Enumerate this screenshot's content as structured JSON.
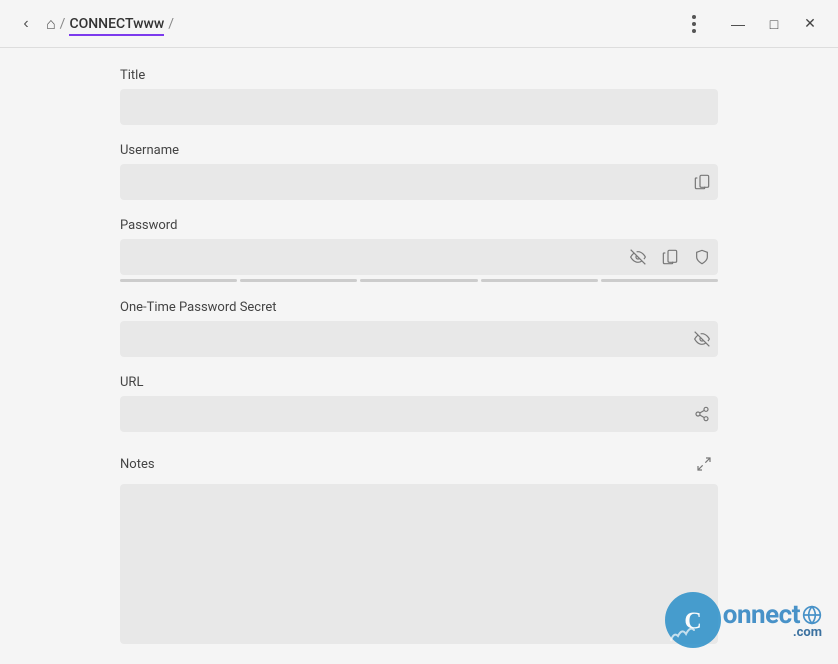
{
  "titlebar": {
    "back_label": "‹",
    "home_icon": "⌂",
    "separator": "/",
    "breadcrumb_root": "CONNECTwww",
    "breadcrumb_sep2": "/",
    "menu_dots": "⋮",
    "minimize_label": "—",
    "maximize_label": "□",
    "close_label": "✕"
  },
  "form": {
    "title_label": "Title",
    "title_placeholder": "",
    "username_label": "Username",
    "username_placeholder": "",
    "password_label": "Password",
    "password_placeholder": "",
    "otp_label": "One-Time Password Secret",
    "otp_placeholder": "",
    "url_label": "URL",
    "url_placeholder": "",
    "notes_label": "Notes",
    "notes_placeholder": ""
  },
  "icons": {
    "clipboard": "📋",
    "eye_off": "◎",
    "shield": "🛡",
    "share": "⎋",
    "expand": "⛶",
    "copy": "⧉"
  },
  "strength_bar": {
    "segments": 5,
    "active": 0
  },
  "watermark": {
    "text": "onnect",
    "suffix": ".com"
  }
}
